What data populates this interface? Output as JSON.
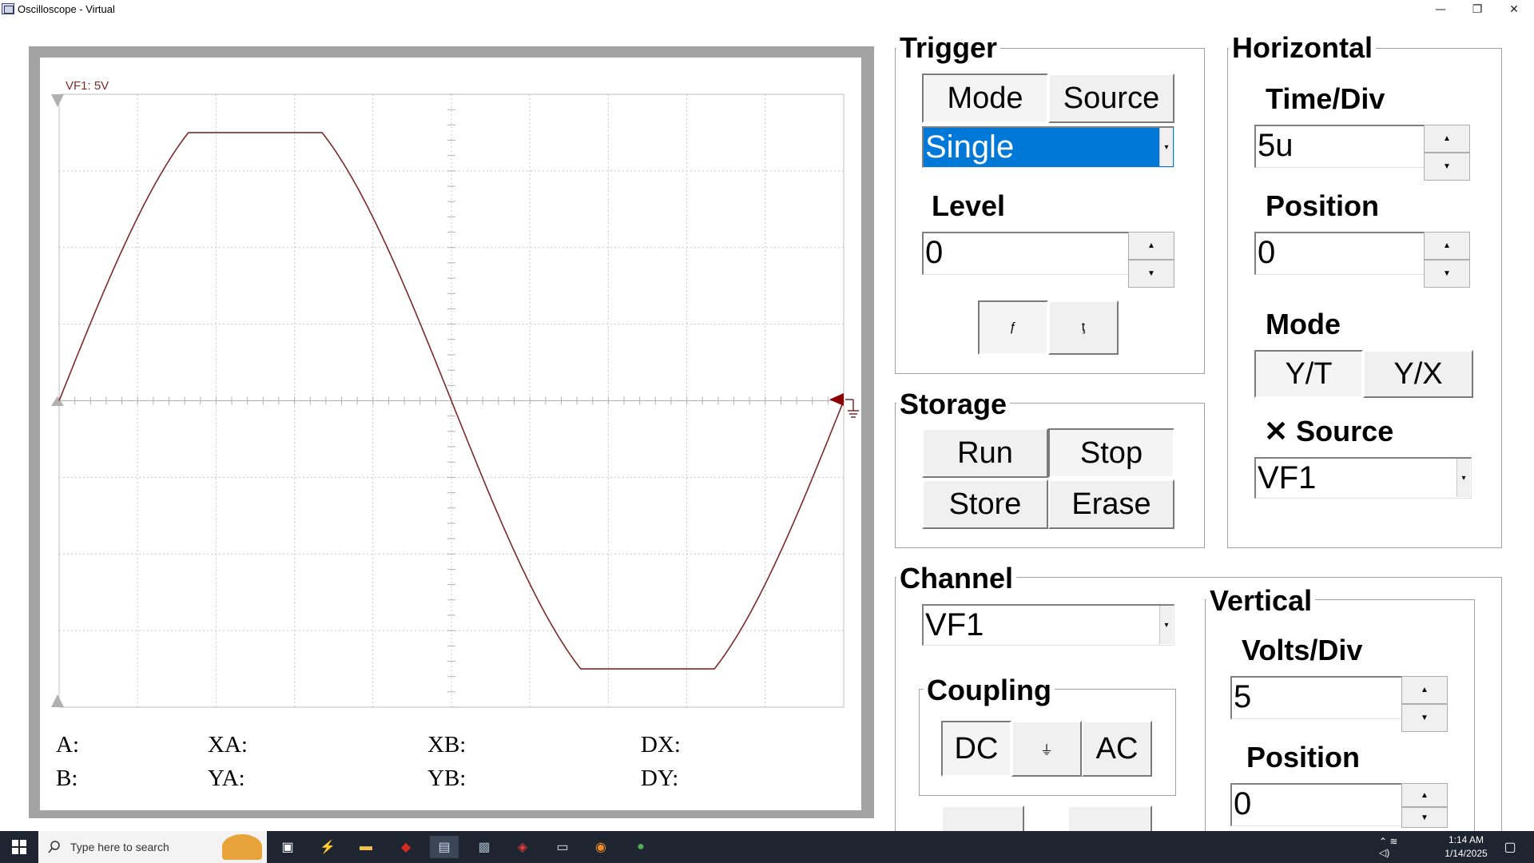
{
  "window": {
    "title": "Oscilloscope - Virtual",
    "controls": {
      "minimize": "—",
      "restore": "❐",
      "close": "✕"
    }
  },
  "scope": {
    "channel_label": "VF1: 5V",
    "trace_color": "#7b2a2a",
    "marker_color": "#8b0000",
    "readouts": {
      "a": "A:",
      "b": "B:",
      "xa": "XA:",
      "ya": "YA:",
      "xb": "XB:",
      "yb": "YB:",
      "dx": "DX:",
      "dy": "DY:"
    }
  },
  "trigger": {
    "title": "Trigger",
    "mode_label": "Mode",
    "source_label": "Source",
    "mode_value": "Single",
    "level_label": "Level",
    "level_value": "0",
    "rising_glyph": "ƒ",
    "falling_glyph": "ţ"
  },
  "storage": {
    "title": "Storage",
    "run_label": "Run",
    "stop_label": "Stop",
    "store_label": "Store",
    "erase_label": "Erase"
  },
  "horizontal": {
    "title": "Horizontal",
    "time_div_label": "Time/Div",
    "time_div_value": "5u",
    "position_label": "Position",
    "position_value": "0",
    "mode_label": "Mode",
    "yt_label": "Y/T",
    "yx_label": "Y/X",
    "xsource_label": "✕ Source",
    "xsource_value": "VF1"
  },
  "channel": {
    "title": "Channel",
    "value": "VF1",
    "coupling_title": "Coupling",
    "dc_label": "DC",
    "gnd_glyph": "⏚",
    "ac_label": "AC"
  },
  "vertical": {
    "title": "Vertical",
    "volts_div_label": "Volts/Div",
    "volts_div_value": "5",
    "position_label": "Position",
    "position_value": "0"
  },
  "taskbar": {
    "search_placeholder": "Type here to search",
    "time": "1:14 AM",
    "date": "1/14/2025",
    "accent": "#0078d7"
  }
}
